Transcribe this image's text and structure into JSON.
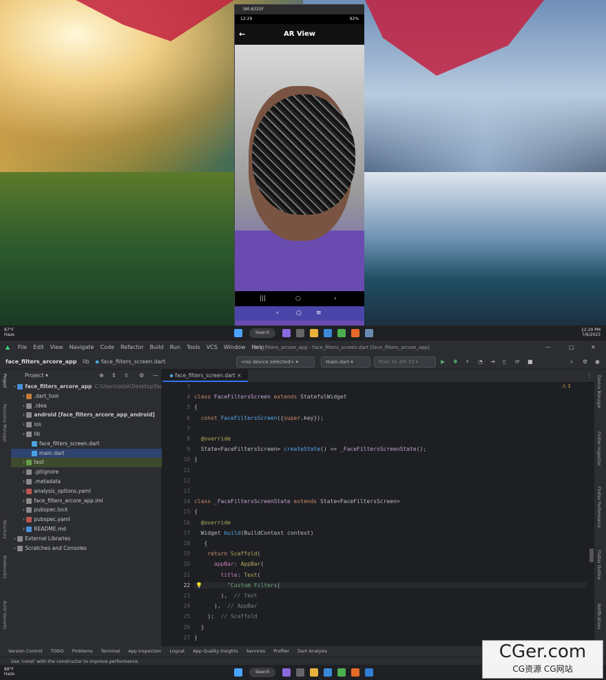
{
  "taskbar_top": {
    "temp": "87°F",
    "weather": "Haze",
    "search": "Search",
    "time": "12:29 PM",
    "date": "7/6/2023"
  },
  "taskbar_bottom": {
    "temp": "88°F",
    "weather": "Haze",
    "search": "Search"
  },
  "phone": {
    "window_title": "SM A325F",
    "status_time": "12:29",
    "status_battery": "92%",
    "appbar_title": "AR View",
    "back_icon": "←",
    "nav_recents": "|||",
    "nav_home": "○",
    "nav_back": "‹",
    "emu_back": "‹",
    "emu_home": "○",
    "emu_menu": "≡"
  },
  "ide": {
    "menu": [
      "File",
      "Edit",
      "View",
      "Navigate",
      "Code",
      "Refactor",
      "Build",
      "Run",
      "Tools",
      "VCS",
      "Window",
      "Help"
    ],
    "window_title": "face_filters_arcore_app - face_filters_screen.dart [face_filters_arcore_app]",
    "breadcrumb": [
      "face_filters_arcore_app",
      "lib",
      "face_filters_screen.dart"
    ],
    "device_selector": "<no device selected>",
    "run_config": "main.dart",
    "emulator": "Pixel XL API 33",
    "project_label": "Project",
    "tree": [
      {
        "label": "face_filters_arcore_app",
        "extra": "C:\\Users\\alize\\Desktop\\face",
        "indent": 0,
        "color": "#4a90d9",
        "bold": true
      },
      {
        "label": ".dart_tool",
        "indent": 1,
        "color": "#c27b3a"
      },
      {
        "label": ".idea",
        "indent": 1,
        "color": "#8a8a8a"
      },
      {
        "label": "android [face_filters_arcore_app_android]",
        "indent": 1,
        "color": "#8a8a8a",
        "bold": true
      },
      {
        "label": "ios",
        "indent": 1,
        "color": "#8a8a8a"
      },
      {
        "label": "lib",
        "indent": 1,
        "color": "#8a8a8a"
      },
      {
        "label": "face_filters_screen.dart",
        "indent": 2,
        "color": "#4aa3df"
      },
      {
        "label": "main.dart",
        "indent": 2,
        "color": "#4aa3df",
        "selected": true
      },
      {
        "label": "test",
        "indent": 1,
        "color": "#6a9a4a",
        "highlight": true
      },
      {
        "label": ".gitignore",
        "indent": 1,
        "color": "#8a8a8a"
      },
      {
        "label": ".metadata",
        "indent": 1,
        "color": "#8a8a8a"
      },
      {
        "label": "analysis_options.yaml",
        "indent": 1,
        "color": "#b55"
      },
      {
        "label": "face_filters_arcore_app.iml",
        "indent": 1,
        "color": "#8a8a8a"
      },
      {
        "label": "pubspec.lock",
        "indent": 1,
        "color": "#8a8a8a"
      },
      {
        "label": "pubspec.yaml",
        "indent": 1,
        "color": "#b55"
      },
      {
        "label": "README.md",
        "indent": 1,
        "color": "#4a90d9"
      },
      {
        "label": "External Libraries",
        "indent": 0,
        "color": "#8a8a8a"
      },
      {
        "label": "Scratches and Consoles",
        "indent": 0,
        "color": "#8a8a8a"
      }
    ],
    "tab": "face_filters_screen.dart",
    "warnings": "⚠ 1",
    "lines": [
      "3",
      "4",
      "5",
      "6",
      "7",
      "8",
      "9",
      "10",
      "11",
      "12",
      "13",
      "14",
      "15",
      "16",
      "17",
      "18",
      "19",
      "20",
      "21",
      "22",
      "23",
      "24",
      "25",
      "26",
      "27"
    ],
    "left_tools": [
      "Project",
      "Resource Manager",
      "Structure",
      "Bookmarks",
      "Build Variants"
    ],
    "right_tools": [
      "Device Manager",
      "Flutter Inspector",
      "Flutter Performance",
      "Flutter Outline",
      "Notifications"
    ],
    "bottom_tools": [
      "Version Control",
      "TODO",
      "Problems",
      "Terminal",
      "App Inspection",
      "Logcat",
      "App Quality Insights",
      "Services",
      "Profiler",
      "Dart Analysis"
    ],
    "status_message": "Use 'const' with the constructor to improve performance."
  },
  "watermark": {
    "line1": "CGer.com",
    "line2": "CG资源 CG网站"
  }
}
